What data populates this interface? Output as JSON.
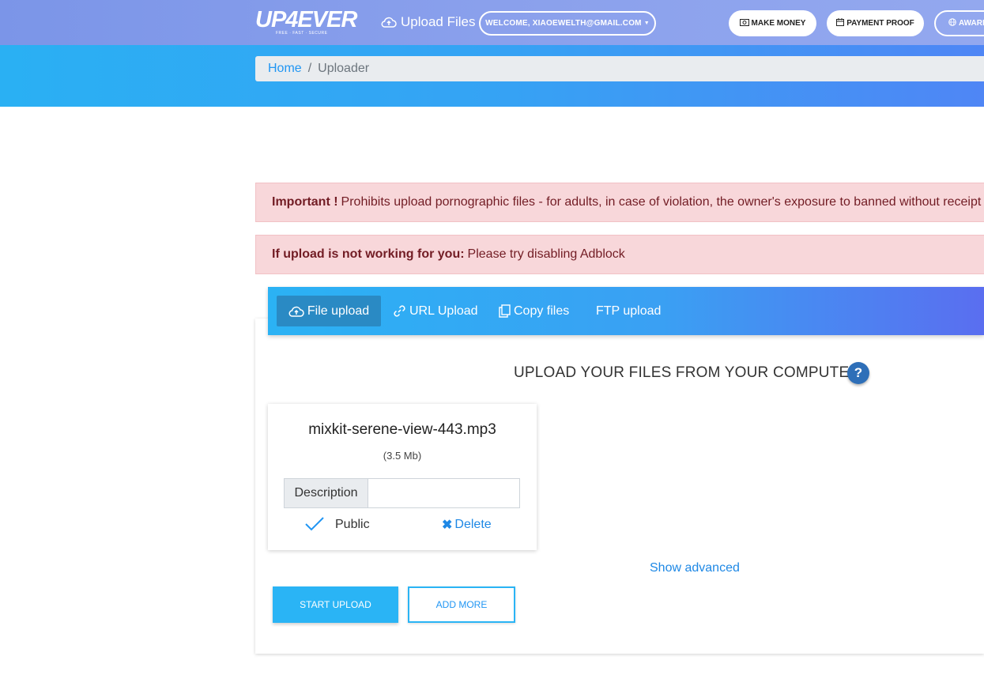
{
  "navbar": {
    "logo_text": "UP4EVER",
    "logo_tagline": "FREE · FAST · SECURE",
    "upload_files_label": "Upload Files",
    "welcome_label": "WELCOME, XIAOEWELTH@GMAIL.COM",
    "make_money_label": "MAKE MONEY",
    "payment_proof_label": "PAYMENT PROOF",
    "award_label": "AWARD"
  },
  "breadcrumb": {
    "home": "Home",
    "separator": "/",
    "current": "Uploader"
  },
  "alerts": {
    "important_bold": "Important !",
    "important_text": "Prohibits upload pornographic files - for adults, in case of violation, the owner's exposure to banned without receipt of t",
    "adblock_bold": "If upload is not working for you:",
    "adblock_text": "Please try disabling Adblock"
  },
  "tabs": {
    "file_upload": "File upload",
    "url_upload": "URL Upload",
    "copy_files": "Copy files",
    "ftp_upload": "FTP upload"
  },
  "upload": {
    "heading": "UPLOAD YOUR FILES FROM YOUR COMPUTER",
    "help_symbol": "?",
    "show_advanced": "Show advanced",
    "start_upload": "START UPLOAD",
    "add_more": "ADD MORE"
  },
  "file": {
    "name": "mixkit-serene-view-443.mp3",
    "size": "(3.5 Mb)",
    "description_label": "Description",
    "description_value": "",
    "public_label": "Public",
    "delete_label": "Delete"
  },
  "colors": {
    "navbar": "#8aa0ec",
    "hero_start": "#2ab0f3",
    "hero_end": "#4f86f5",
    "alert_bg": "#f8d7da",
    "alert_text": "#721c24",
    "link": "#1e88e5",
    "primary": "#2ab4f5"
  },
  "icons": {
    "upload_files": "cloud-upload-icon",
    "make_money": "money-icon",
    "payment_proof": "calendar-icon",
    "award": "globe-icon",
    "tab_file": "cloud-upload-icon",
    "tab_url": "link-icon",
    "tab_copy": "copy-icon",
    "help": "help-icon",
    "public": "check-icon",
    "delete": "close-icon"
  }
}
